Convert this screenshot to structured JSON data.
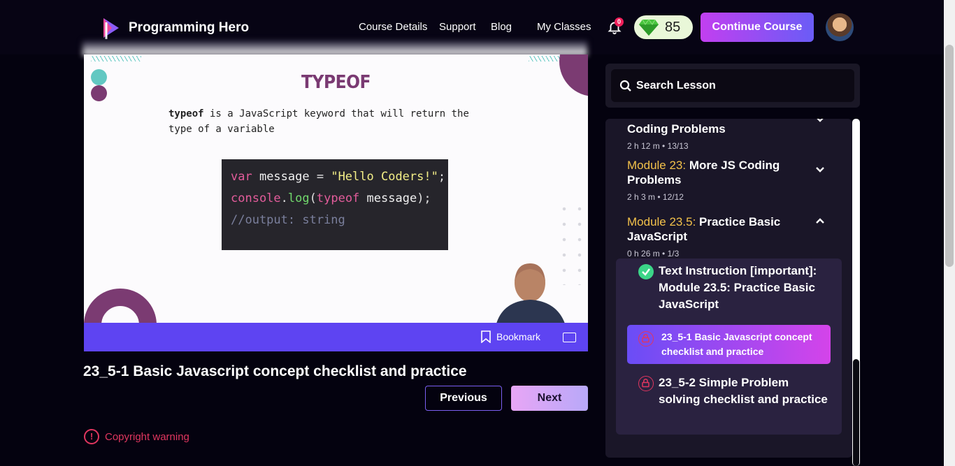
{
  "header": {
    "brand": "Programming Hero",
    "nav": [
      "Course Details",
      "Support",
      "Blog",
      "My Classes"
    ],
    "notification_count": "0",
    "gems": "85",
    "continue_label": "Continue Course"
  },
  "video": {
    "title": "TYPEOF",
    "desc_keyword": "typeof",
    "desc_rest": " is a JavaScript keyword that will return the type of a variable",
    "code": {
      "line1": [
        "var",
        " message ",
        "=",
        " \"Hello Coders!\"",
        ";"
      ],
      "line2": [
        "console",
        ".",
        "log",
        "(",
        "typeof",
        " message",
        ");"
      ],
      "line3": "//output: string"
    },
    "bookmark_label": "Bookmark"
  },
  "lesson": {
    "title": "23_5-1 Basic Javascript concept checklist and practice",
    "prev_label": "Previous",
    "next_label": "Next",
    "copyright": "Copyright warning"
  },
  "sidebar": {
    "search_placeholder": "Search Lesson",
    "modules": [
      {
        "num": "",
        "title": "Coding Problems",
        "meta": "2 h 12 m •  13/13"
      },
      {
        "num": "Module 23:",
        "title": " More JS Coding Problems",
        "meta": "2 h 3 m •  12/12"
      },
      {
        "num": "Module 23.5:",
        "title": " Practice Basic JavaScript",
        "meta": "0 h 26 m •  1/3"
      }
    ],
    "lessons": [
      {
        "label": "Text Instruction [important]: Module 23.5: Practice Basic JavaScript",
        "status": "completed"
      },
      {
        "label": "23_5-1 Basic Javascript concept checklist and practice",
        "status": "active"
      },
      {
        "label": "23_5-2 Simple Problem solving checklist and practice",
        "status": "locked"
      }
    ]
  },
  "colors": {
    "accent": "#5e44f2",
    "module_number": "#f2c14a",
    "warning": "#e0365f",
    "success": "#3bd588"
  }
}
